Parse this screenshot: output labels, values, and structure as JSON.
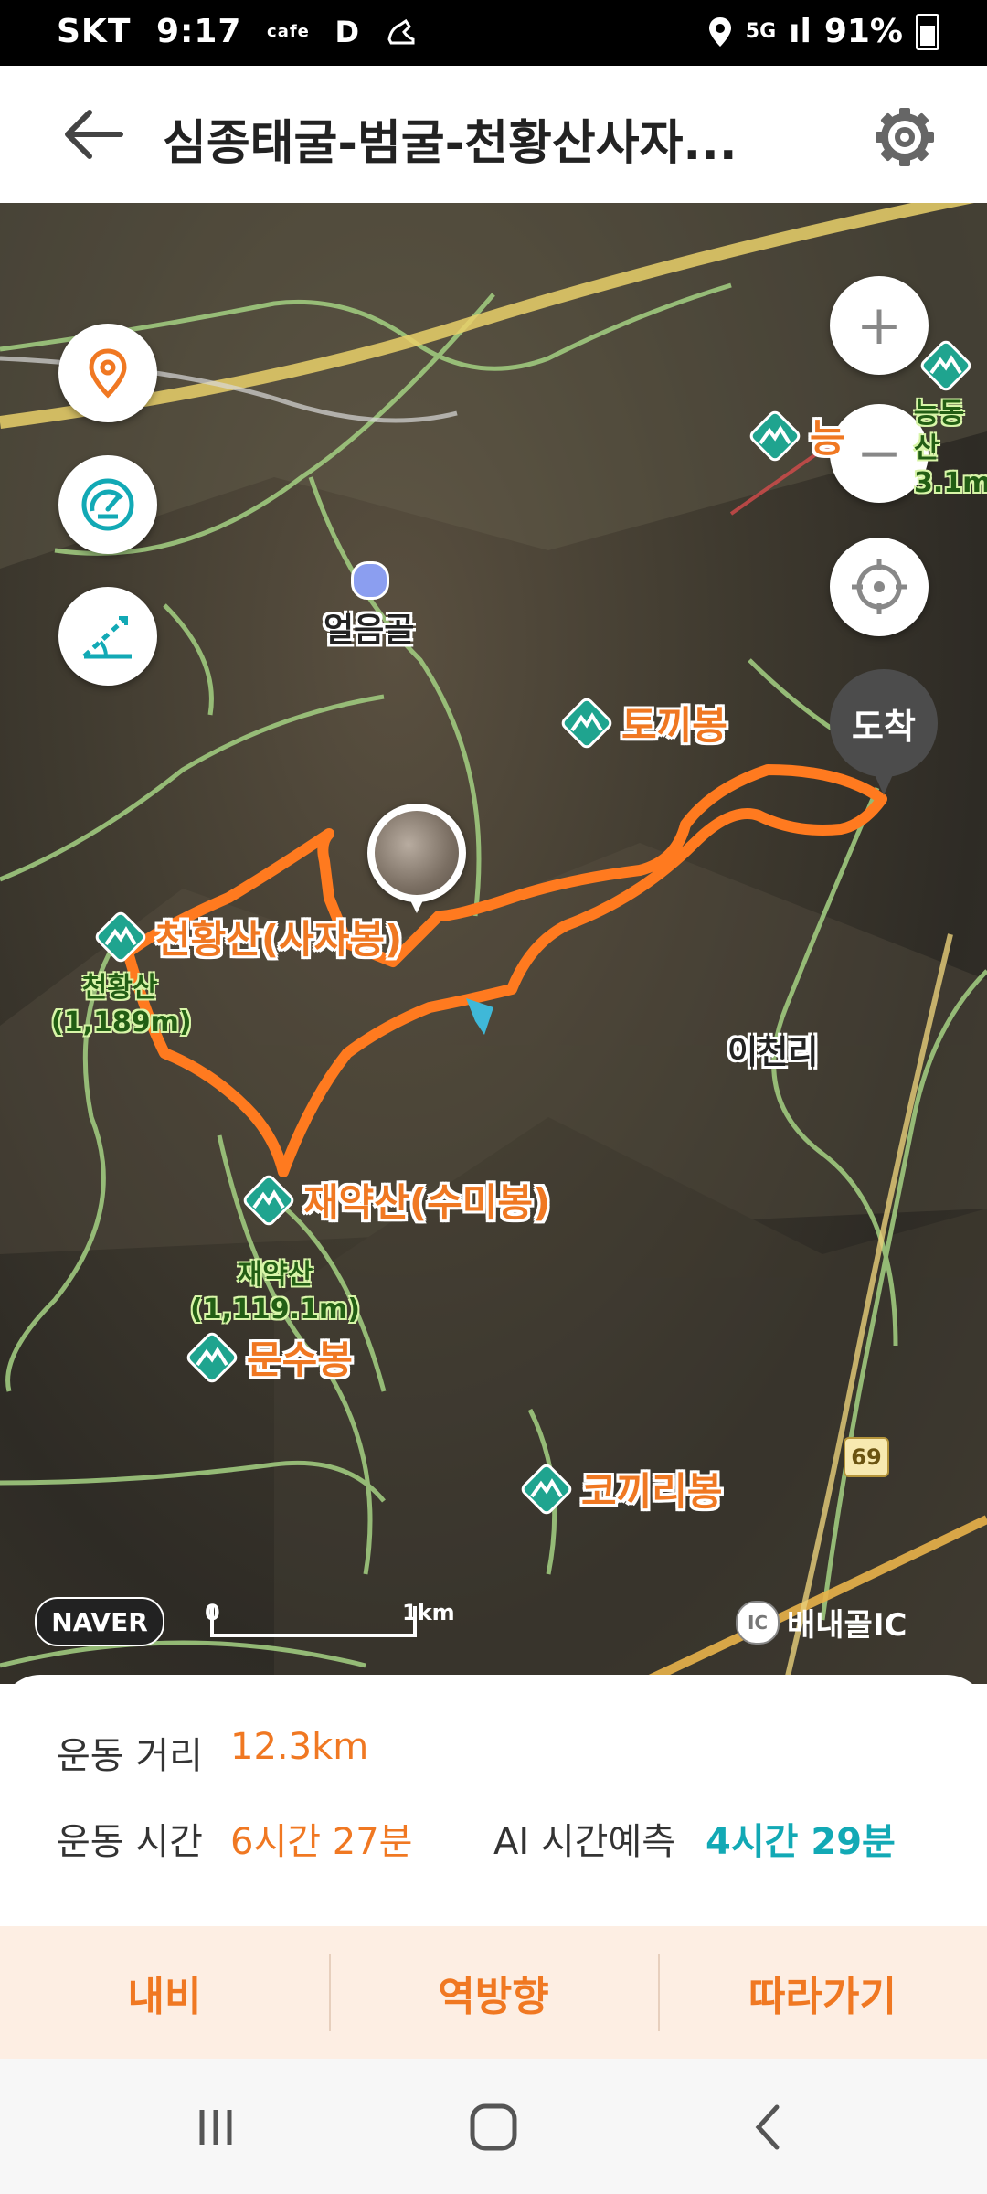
{
  "status_bar": {
    "carrier": "SKT",
    "time": "9:17",
    "cafe": "cafe",
    "d": "D",
    "network": "5G",
    "signal": "ıl",
    "battery": "91%"
  },
  "app_bar": {
    "title": "심종태굴-범굴-천황산사자..."
  },
  "map": {
    "buttons": [
      "location-pin-icon",
      "speedometer-icon",
      "slope-icon"
    ],
    "zoom_in": "+",
    "zoom_out": "−",
    "arrival_label": "도착",
    "peaks": {
      "tokkibong": "토끼봉",
      "cheonhwangsan_saja": "천황산(사자봉)",
      "jaeyaksan_sumi": "재약산(수미봉)",
      "munsubong": "문수봉",
      "kokkiribong": "코끼리봉"
    },
    "elevations": {
      "cheonhwangsan": "천황산",
      "cheonhwangsan_height": "(1,189m)",
      "jaeyaksan": "재약산",
      "jaeyaksan_height": "(1,119.1m)",
      "nakdongsan": "능동산",
      "nakdongsan_height": "3.1m"
    },
    "places": {
      "eoreumgol": "얼음골",
      "icheonri": "이천리",
      "ic": "배내골IC",
      "ic_badge": "IC",
      "route": "69",
      "partial_peak": "능"
    },
    "naver": "NAVER",
    "scale_start": "0",
    "scale_end": "1km"
  },
  "stats": {
    "distance_label": "운동 거리",
    "distance_value": "12.3km",
    "time_label": "운동 시간",
    "time_value": "6시간 27분",
    "ai_label": "AI 시간예측",
    "ai_value": "4시간 29분"
  },
  "actions": {
    "navi": "내비",
    "reverse": "역방향",
    "follow": "따라가기"
  },
  "colors": {
    "accent": "#f07822",
    "teal": "#12a9b5",
    "peak_icon": "#1fa48f"
  }
}
